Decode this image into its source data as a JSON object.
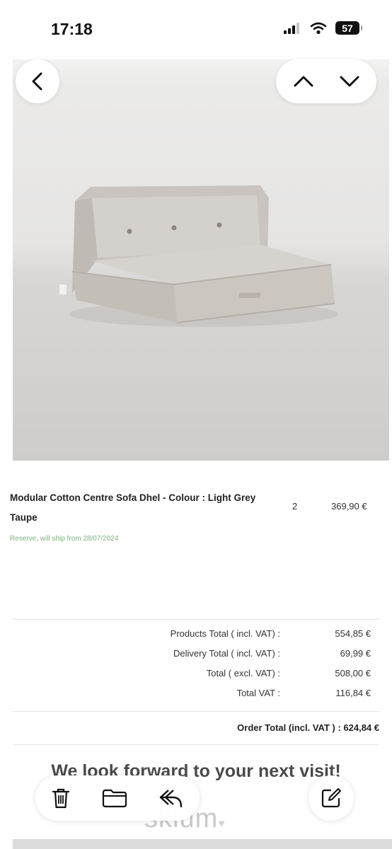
{
  "status": {
    "time": "17:18",
    "battery": "57",
    "icons": [
      "signal-icon",
      "wifi-icon",
      "battery-icon"
    ]
  },
  "nav": {
    "back_icon": "chevron-left-icon",
    "prev_icon": "chevron-up-icon",
    "next_icon": "chevron-down-icon"
  },
  "product": {
    "name": "Modular Cotton Centre Sofa Dhel - Colour : Light Grey Taupe",
    "quantity": "2",
    "price": "369,90 €",
    "reserve_note": "Reserve, will ship from 28/07/2024"
  },
  "totals": [
    {
      "label": "Products Total ( incl. VAT) :",
      "value": "554,85 €"
    },
    {
      "label": "Delivery Total ( incl. VAT) :",
      "value": "69,99 €"
    },
    {
      "label": "Total ( excl. VAT) :",
      "value": "508,00 €"
    },
    {
      "label": "Total VAT :",
      "value": "116,84 €"
    }
  ],
  "order_total": "Order Total (incl. VAT ) : 624,84 €",
  "footer": {
    "visit_message": "We look forward to your next visit!",
    "logo": "sklum"
  },
  "toolbar": {
    "icons": [
      "trash-icon",
      "folder-icon",
      "reply-icon",
      "compose-icon"
    ]
  },
  "colors": {
    "accent_green": "#7bb27a",
    "background": "#ffffff"
  }
}
